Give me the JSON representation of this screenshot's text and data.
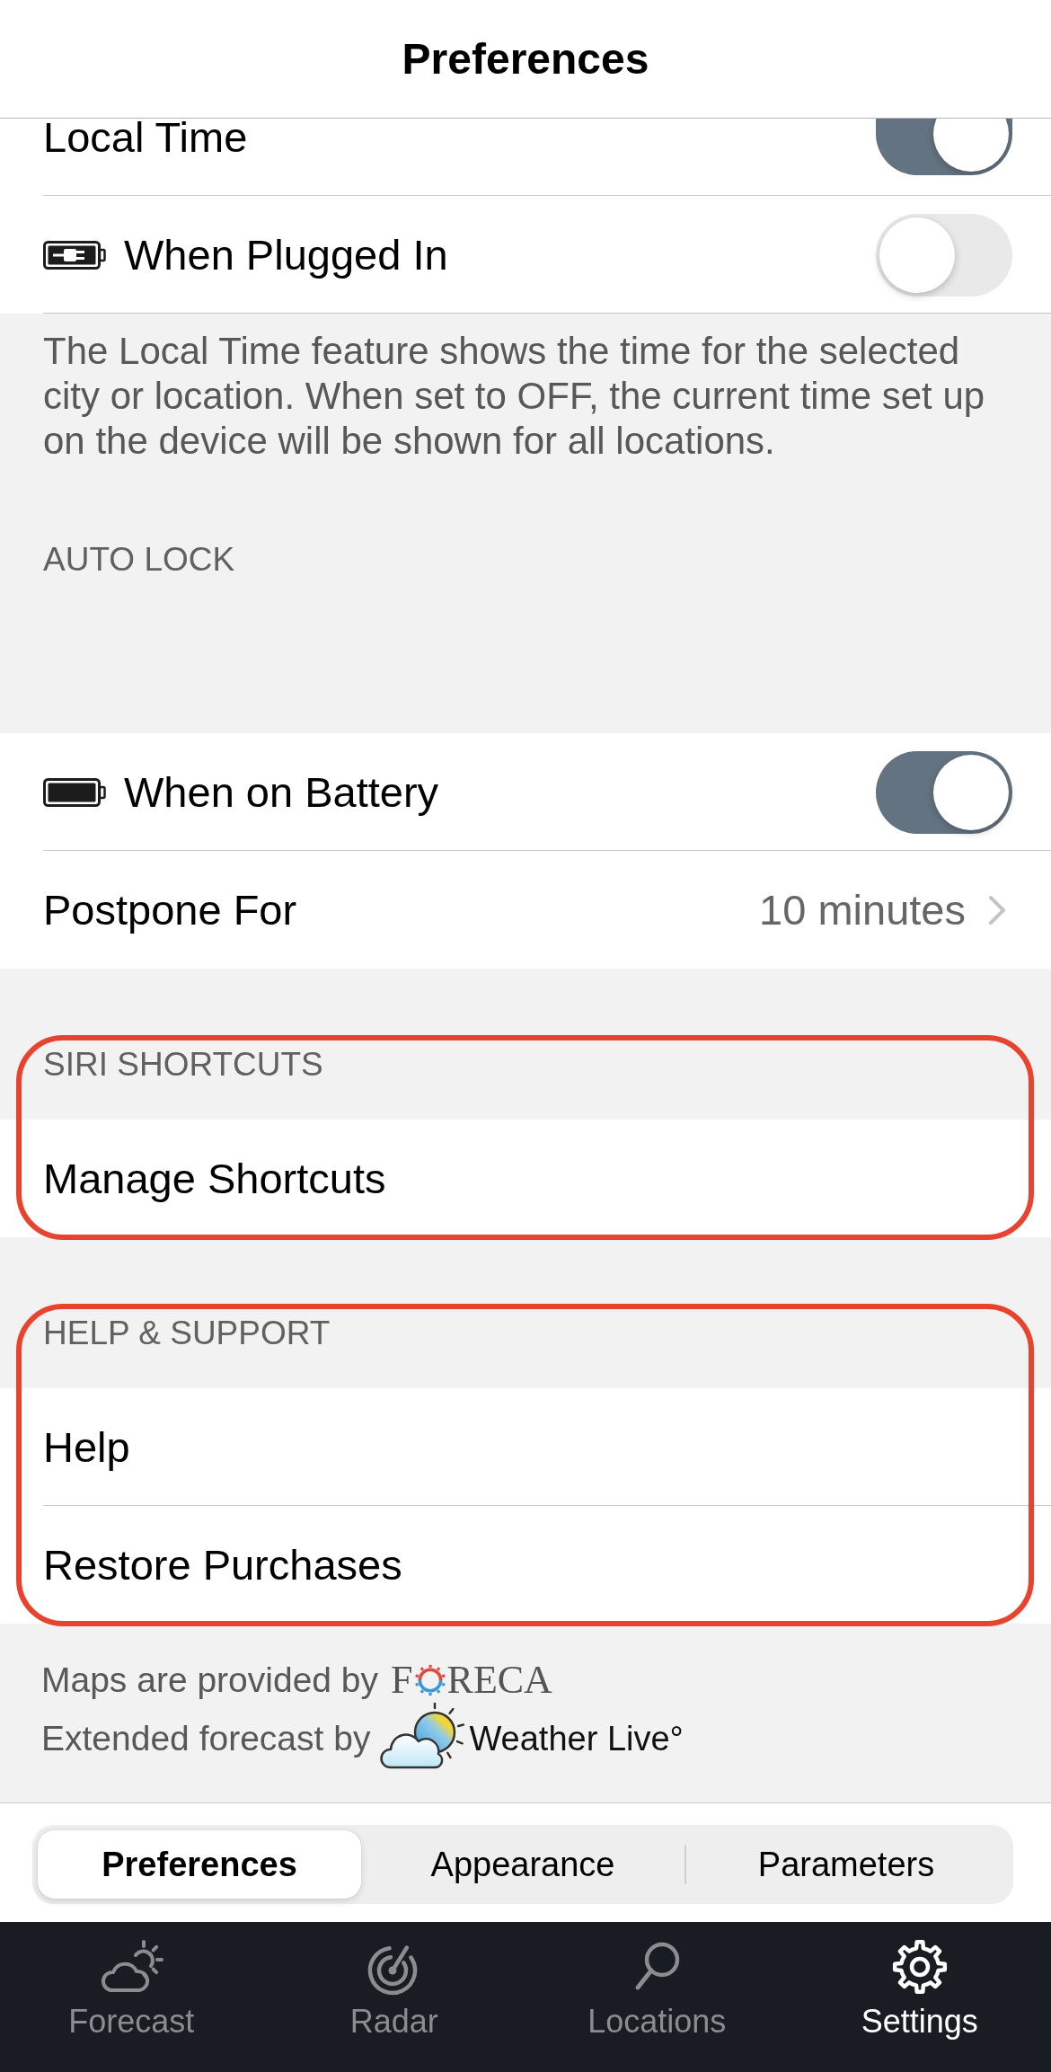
{
  "nav_bar": {
    "title": "Preferences"
  },
  "sections": [
    {
      "highlighted": false,
      "rows": [
        {
          "kind": "switch",
          "label": "Local Time",
          "on": true
        },
        {
          "kind": "plug_switch",
          "label": "When Plugged In",
          "on": false
        }
      ],
      "footer": "The Local Time feature shows the time for the selected city or location. When set to OFF, the current time set up on the device will be shown for all locations."
    },
    {
      "header": "AUTO LOCK",
      "highlighted": false,
      "rows": [
        {
          "kind": "battery_switch",
          "label": "When on Battery",
          "on": true
        },
        {
          "kind": "value",
          "label": "Postpone For",
          "value": "10 minutes"
        }
      ]
    },
    {
      "header": "SIRI SHORTCUTS",
      "highlighted": true,
      "rows": [
        {
          "kind": "link",
          "label": "Manage Shortcuts"
        }
      ]
    },
    {
      "header": "HELP & SUPPORT",
      "highlighted": true,
      "rows": [
        {
          "kind": "link",
          "label": "Help"
        },
        {
          "kind": "link",
          "label": "Restore Purchases"
        }
      ]
    }
  ],
  "credits": [
    {
      "kind": "maps",
      "text": "Maps are provided by",
      "logo": [
        "F",
        "RECA"
      ]
    },
    {
      "kind": "forecast",
      "text": "Extended forecast by",
      "logo": [
        "Weather Live°"
      ]
    }
  ],
  "segments": [
    {
      "label": "Preferences",
      "selected": true
    },
    {
      "label": "Appearance",
      "selected": false
    },
    {
      "label": "Parameters",
      "selected": false
    }
  ],
  "tab_bar": [
    {
      "kind": "weather",
      "label": "Forecast",
      "selected": false
    },
    {
      "kind": "radar",
      "label": "Radar",
      "selected": false
    },
    {
      "kind": "search",
      "label": "Locations",
      "selected": false
    },
    {
      "kind": "settings",
      "label": "Settings",
      "selected": true
    }
  ]
}
